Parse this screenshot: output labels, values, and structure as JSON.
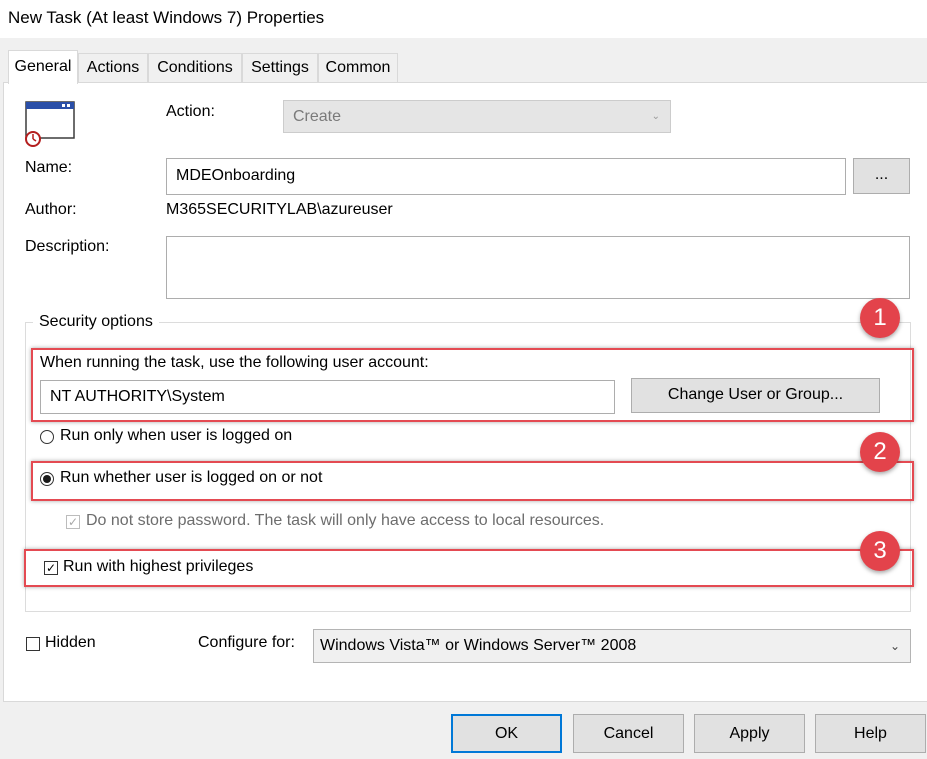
{
  "window": {
    "title": "New Task (At least Windows 7) Properties"
  },
  "tabs": [
    {
      "label": "General",
      "active": true
    },
    {
      "label": "Actions",
      "active": false
    },
    {
      "label": "Conditions",
      "active": false
    },
    {
      "label": "Settings",
      "active": false
    },
    {
      "label": "Common",
      "active": false
    }
  ],
  "general": {
    "action_label": "Action:",
    "action_value": "Create",
    "name_label": "Name:",
    "name_value": "MDEOnboarding",
    "browse_label": "...",
    "author_label": "Author:",
    "author_value": "M365SECURITYLAB\\azureuser",
    "description_label": "Description:",
    "description_value": ""
  },
  "security": {
    "legend": "Security options",
    "account_prompt": "When running the task, use the following user account:",
    "account_value": "NT AUTHORITY\\System",
    "change_user_label": "Change User or Group...",
    "run_logged_on_label": "Run only when user is logged on",
    "run_whether_label": "Run whether user is logged on or not",
    "run_whether_selected": true,
    "no_store_password_label": "Do not store password.  The task will only have access to local resources.",
    "highest_privileges_label": "Run with highest privileges"
  },
  "bottom": {
    "hidden_label": "Hidden",
    "configure_label": "Configure for:",
    "configure_value": "Windows Vista™ or Windows Server™ 2008"
  },
  "buttons": {
    "ok": "OK",
    "cancel": "Cancel",
    "apply": "Apply",
    "help": "Help"
  },
  "annotations": [
    "1",
    "2",
    "3"
  ],
  "colors": {
    "highlight": "#e44a52",
    "badge": "#e3434b",
    "default_button_border": "#0078d7"
  }
}
